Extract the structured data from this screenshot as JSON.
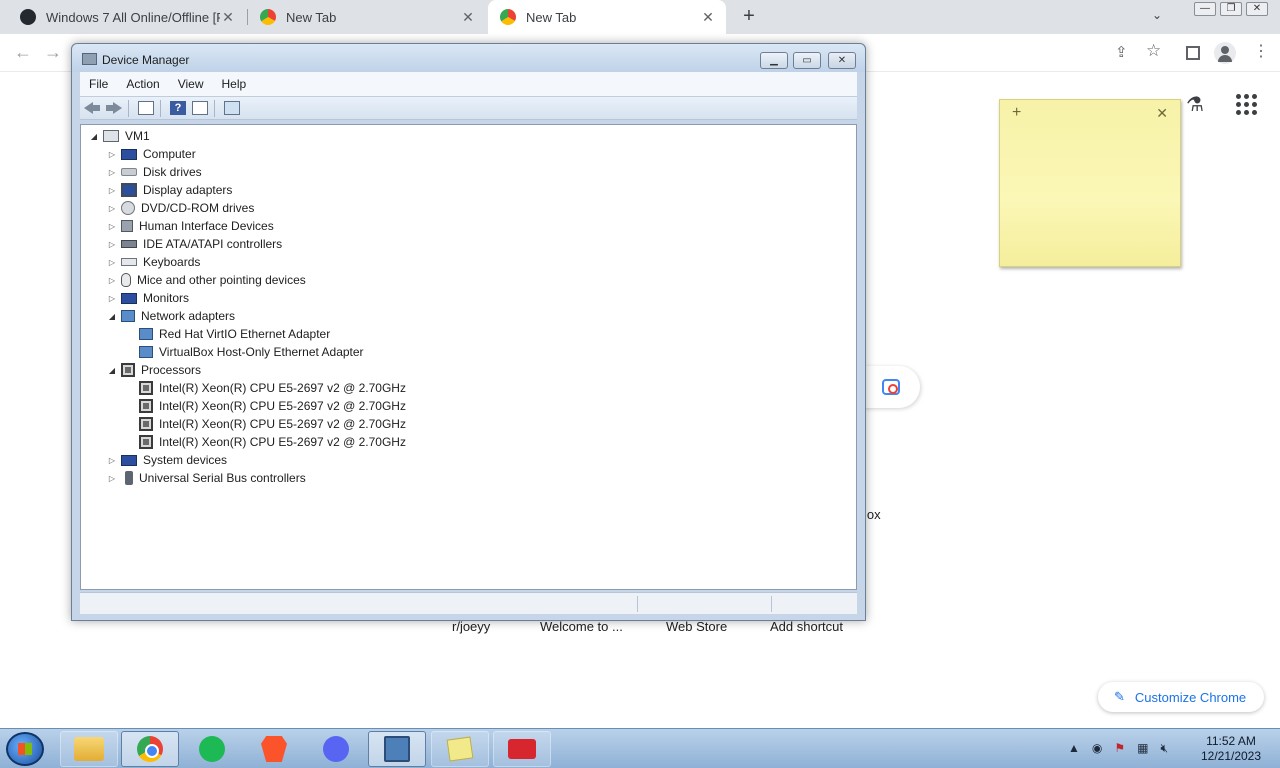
{
  "browser": {
    "tabs": [
      {
        "title": "Windows 7 All Online/Offline [Re",
        "active": false
      },
      {
        "title": "New Tab",
        "active": false
      },
      {
        "title": "New Tab",
        "active": true
      }
    ],
    "new_tab_symbol": "+",
    "close_symbol": "✕",
    "tab_search_symbol": "⌄",
    "window_buttons": [
      "—",
      "❐",
      "✕"
    ],
    "nav": {
      "back": "←",
      "forward": "→"
    },
    "toolbar_icons": [
      "share-icon",
      "star-icon",
      "side-panel-icon",
      "profile-icon",
      "kebab-menu-icon"
    ]
  },
  "ntp": {
    "shortcut_labels": [
      "r/joeyy",
      "Welcome to ...",
      "Web Store",
      "Add shortcut"
    ],
    "partial_shortcut": "lox",
    "customize_label": "Customize Chrome",
    "labs_icon": "flask-icon",
    "apps_icon": "apps-grid-icon"
  },
  "sticky_note": {
    "add": "+",
    "close": "✕"
  },
  "device_manager": {
    "title": "Device Manager",
    "menu": [
      "File",
      "Action",
      "View",
      "Help"
    ],
    "root": "VM1",
    "items": [
      {
        "label": "Computer",
        "icon": "computer-icon",
        "expanded": false,
        "children": []
      },
      {
        "label": "Disk drives",
        "icon": "disk-drive-icon",
        "expanded": false,
        "children": []
      },
      {
        "label": "Display adapters",
        "icon": "display-adapter-icon",
        "expanded": false,
        "children": []
      },
      {
        "label": "DVD/CD-ROM drives",
        "icon": "dvd-drive-icon",
        "expanded": false,
        "children": []
      },
      {
        "label": "Human Interface Devices",
        "icon": "hid-icon",
        "expanded": false,
        "children": []
      },
      {
        "label": "IDE ATA/ATAPI controllers",
        "icon": "ide-controller-icon",
        "expanded": false,
        "children": []
      },
      {
        "label": "Keyboards",
        "icon": "keyboard-icon",
        "expanded": false,
        "children": []
      },
      {
        "label": "Mice and other pointing devices",
        "icon": "mouse-icon",
        "expanded": false,
        "children": []
      },
      {
        "label": "Monitors",
        "icon": "monitor-icon",
        "expanded": false,
        "children": []
      },
      {
        "label": "Network adapters",
        "icon": "network-adapter-icon",
        "expanded": true,
        "children": [
          "Red Hat VirtIO Ethernet Adapter",
          "VirtualBox Host-Only Ethernet Adapter"
        ]
      },
      {
        "label": "Processors",
        "icon": "processor-icon",
        "expanded": true,
        "children": [
          "Intel(R) Xeon(R) CPU E5-2697 v2 @ 2.70GHz",
          "Intel(R) Xeon(R) CPU E5-2697 v2 @ 2.70GHz",
          "Intel(R) Xeon(R) CPU E5-2697 v2 @ 2.70GHz",
          "Intel(R) Xeon(R) CPU E5-2697 v2 @ 2.70GHz"
        ]
      },
      {
        "label": "System devices",
        "icon": "system-devices-icon",
        "expanded": false,
        "children": []
      },
      {
        "label": "Universal Serial Bus controllers",
        "icon": "usb-icon",
        "expanded": false,
        "children": []
      }
    ]
  },
  "taskbar": {
    "apps": [
      "File Explorer",
      "Google Chrome",
      "Spotify",
      "Brave",
      "Discord",
      "Device Manager",
      "Sticky Notes",
      "Toolbox"
    ],
    "clock_time": "11:52 AM",
    "clock_date": "12/21/2023",
    "tray_up": "▲"
  },
  "colors": {
    "chrome_frame": "#dee1e6",
    "win7_title": "#bfd2e8",
    "sticky": "#f7f2a8",
    "accent_blue": "#1a73e8"
  }
}
